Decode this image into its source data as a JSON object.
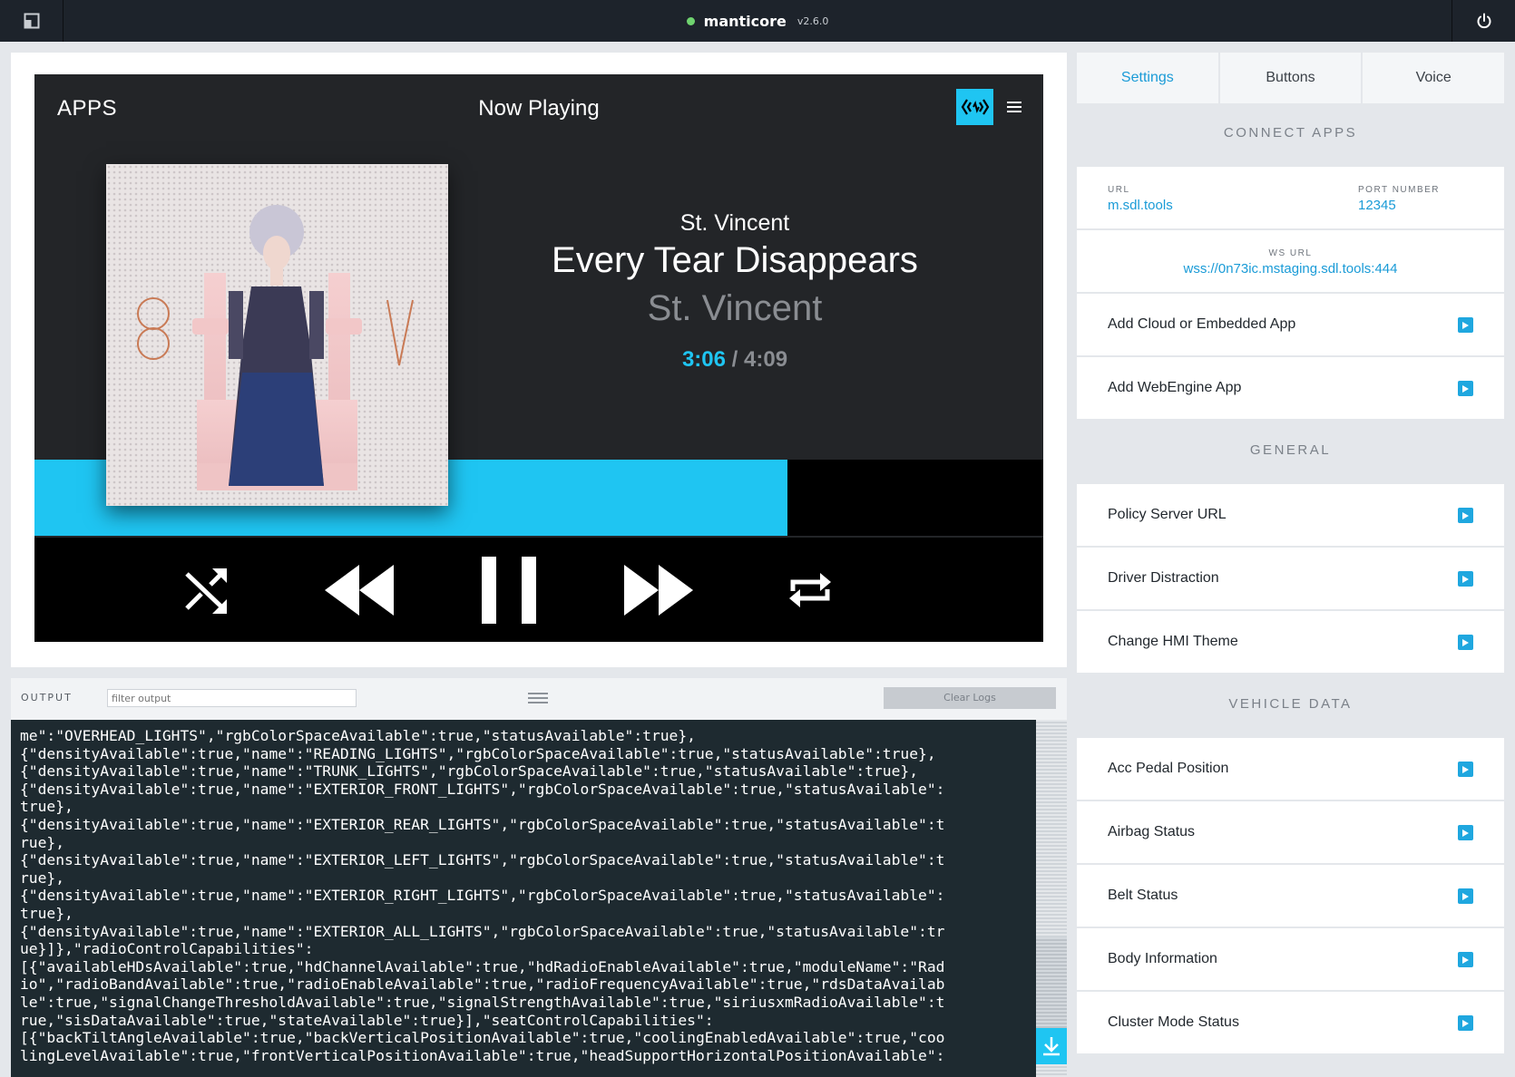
{
  "topbar": {
    "app_name": "manticore",
    "version": "v2.6.0",
    "status_color": "#6fd36f"
  },
  "hmi": {
    "apps_label": "APPS",
    "screen_title": "Now Playing",
    "artist": "St. Vincent",
    "song": "Every Tear Disappears",
    "album": "St. Vincent",
    "time_current": "3:06",
    "time_separator": " / ",
    "time_total": "4:09",
    "progress_fraction": 0.7466,
    "accent_color": "#1fc5f2",
    "icons": {
      "cloud": "cloud-sync-icon",
      "menu": "hamburger-menu-icon",
      "shuffle": "shuffle-icon",
      "rewind": "rewind-icon",
      "pause": "pause-icon",
      "forward": "fast-forward-icon",
      "repeat": "repeat-icon"
    }
  },
  "output": {
    "label": "OUTPUT",
    "filter_placeholder": "filter output",
    "clear_label": "Clear Logs",
    "log_lines": [
      "me\":\"OVERHEAD_LIGHTS\",\"rgbColorSpaceAvailable\":true,\"statusAvailable\":true},",
      "{\"densityAvailable\":true,\"name\":\"READING_LIGHTS\",\"rgbColorSpaceAvailable\":true,\"statusAvailable\":true},",
      "{\"densityAvailable\":true,\"name\":\"TRUNK_LIGHTS\",\"rgbColorSpaceAvailable\":true,\"statusAvailable\":true},",
      "{\"densityAvailable\":true,\"name\":\"EXTERIOR_FRONT_LIGHTS\",\"rgbColorSpaceAvailable\":true,\"statusAvailable\":",
      "true},",
      "{\"densityAvailable\":true,\"name\":\"EXTERIOR_REAR_LIGHTS\",\"rgbColorSpaceAvailable\":true,\"statusAvailable\":t",
      "rue},",
      "{\"densityAvailable\":true,\"name\":\"EXTERIOR_LEFT_LIGHTS\",\"rgbColorSpaceAvailable\":true,\"statusAvailable\":t",
      "rue},",
      "{\"densityAvailable\":true,\"name\":\"EXTERIOR_RIGHT_LIGHTS\",\"rgbColorSpaceAvailable\":true,\"statusAvailable\":",
      "true},",
      "{\"densityAvailable\":true,\"name\":\"EXTERIOR_ALL_LIGHTS\",\"rgbColorSpaceAvailable\":true,\"statusAvailable\":tr",
      "ue}]},\"radioControlCapabilities\":",
      "[{\"availableHDsAvailable\":true,\"hdChannelAvailable\":true,\"hdRadioEnableAvailable\":true,\"moduleName\":\"Rad",
      "io\",\"radioBandAvailable\":true,\"radioEnableAvailable\":true,\"radioFrequencyAvailable\":true,\"rdsDataAvailab",
      "le\":true,\"signalChangeThresholdAvailable\":true,\"signalStrengthAvailable\":true,\"siriusxmRadioAvailable\":t",
      "rue,\"sisDataAvailable\":true,\"stateAvailable\":true}],\"seatControlCapabilities\":",
      "[{\"backTiltAngleAvailable\":true,\"backVerticalPositionAvailable\":true,\"coolingEnabledAvailable\":true,\"coo",
      "lingLevelAvailable\":true,\"frontVerticalPositionAvailable\":true,\"headSupportHorizontalPositionAvailable\":"
    ]
  },
  "sidebar": {
    "tabs": [
      {
        "label": "Settings",
        "active": true
      },
      {
        "label": "Buttons",
        "active": false
      },
      {
        "label": "Voice",
        "active": false
      }
    ],
    "connect_title": "CONNECT APPS",
    "url_label": "URL",
    "url_value": "m.sdl.tools",
    "port_label": "PORT NUMBER",
    "port_value": "12345",
    "ws_label": "WS URL",
    "ws_value": "wss://0n73ic.mstaging.sdl.tools:444",
    "connect_items": [
      "Add Cloud or Embedded App",
      "Add WebEngine App"
    ],
    "general_title": "GENERAL",
    "general_items": [
      "Policy Server URL",
      "Driver Distraction",
      "Change HMI Theme"
    ],
    "vehicle_title": "VEHICLE DATA",
    "vehicle_items": [
      "Acc Pedal Position",
      "Airbag Status",
      "Belt Status",
      "Body Information",
      "Cluster Mode Status"
    ]
  }
}
